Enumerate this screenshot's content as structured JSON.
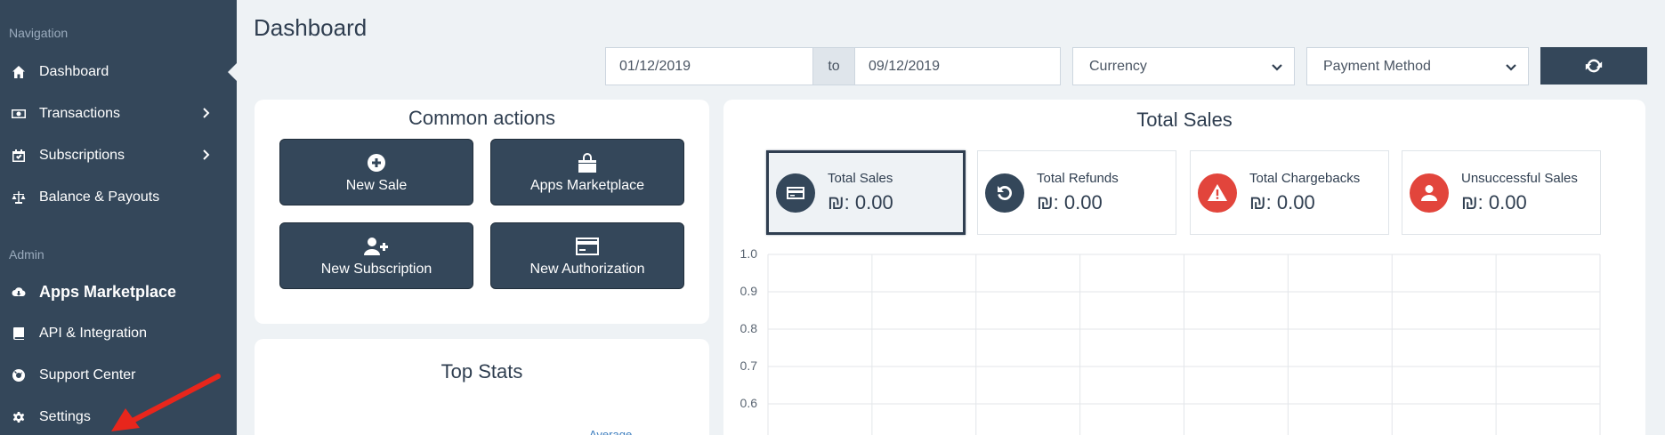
{
  "sidebar": {
    "sections": {
      "navigation": "Navigation",
      "admin": "Admin"
    },
    "items": [
      {
        "label": "Dashboard",
        "icon": "home-icon",
        "active": true
      },
      {
        "label": "Transactions",
        "icon": "money-icon",
        "has_submenu": true
      },
      {
        "label": "Subscriptions",
        "icon": "calendar-check-icon",
        "has_submenu": true
      },
      {
        "label": "Balance & Payouts",
        "icon": "balance-scale-icon"
      },
      {
        "label": "Apps Marketplace",
        "icon": "cloud-download-icon"
      },
      {
        "label": "API & Integration",
        "icon": "book-icon"
      },
      {
        "label": "Support Center",
        "icon": "life-ring-icon"
      },
      {
        "label": "Settings",
        "icon": "gear-icon"
      }
    ]
  },
  "header": {
    "title": "Dashboard",
    "date_from": "01/12/2019",
    "date_to_label": "to",
    "date_to": "09/12/2019",
    "currency_select": "Currency",
    "payment_method_select": "Payment Method",
    "refresh_icon": "refresh-icon"
  },
  "common_actions": {
    "title": "Common actions",
    "buttons": [
      {
        "label": "New Sale",
        "icon": "plus-circle-icon"
      },
      {
        "label": "Apps Marketplace",
        "icon": "shopping-bag-icon"
      },
      {
        "label": "New Subscription",
        "icon": "user-plus-icon"
      },
      {
        "label": "New Authorization",
        "icon": "credit-card-icon"
      }
    ]
  },
  "top_stats": {
    "title": "Top Stats",
    "partial_text": "Average"
  },
  "total_sales": {
    "title": "Total Sales",
    "tiles": [
      {
        "label": "Total Sales",
        "value": "₪: 0.00",
        "icon": "credit-card-icon",
        "color": "#34475a",
        "selected": true
      },
      {
        "label": "Total Refunds",
        "value": "₪: 0.00",
        "icon": "undo-icon",
        "color": "#34475a"
      },
      {
        "label": "Total Chargebacks",
        "value": "₪: 0.00",
        "icon": "warning-icon",
        "color": "#e2453c"
      },
      {
        "label": "Unsuccessful Sales",
        "value": "₪: 0.00",
        "icon": "user-icon",
        "color": "#e2453c"
      }
    ]
  },
  "chart_data": {
    "type": "line",
    "title": "",
    "xlabel": "",
    "ylabel": "",
    "y_ticks": [
      "1.0",
      "0.9",
      "0.8",
      "0.7",
      "0.6"
    ],
    "ylim": [
      0,
      1
    ],
    "grid": true,
    "series": []
  },
  "annotation": {
    "arrow_color": "#e8261c",
    "points_to": "Settings"
  }
}
